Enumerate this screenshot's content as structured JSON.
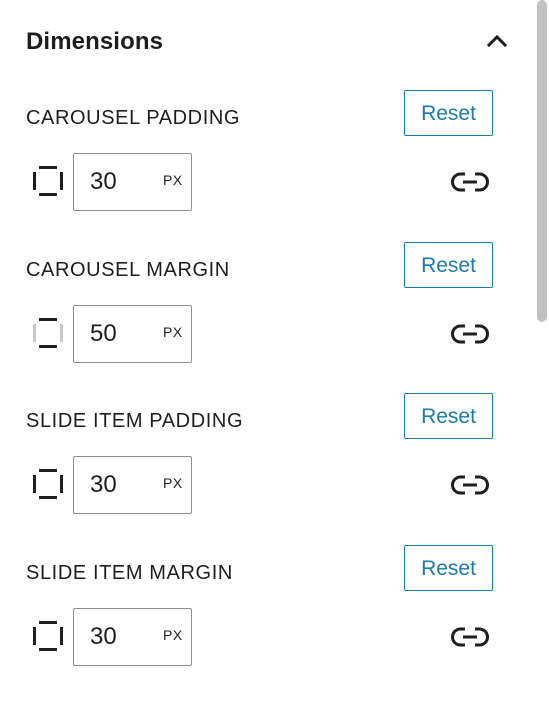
{
  "panel": {
    "title": "Dimensions",
    "expanded": true,
    "collapse_icon": "chevron-up-icon"
  },
  "sections": [
    {
      "label": "CAROUSEL PADDING",
      "reset_label": "Reset",
      "value": "30",
      "unit": "PX",
      "sides_icon": "all-sides-icon",
      "link_icon": "link-icon"
    },
    {
      "label": "CAROUSEL MARGIN",
      "reset_label": "Reset",
      "value": "50",
      "unit": "PX",
      "sides_icon": "vertical-sides-icon",
      "link_icon": "link-icon"
    },
    {
      "label": "SLIDE ITEM PADDING",
      "reset_label": "Reset",
      "value": "30",
      "unit": "PX",
      "sides_icon": "all-sides-icon",
      "link_icon": "link-icon"
    },
    {
      "label": "SLIDE ITEM MARGIN",
      "reset_label": "Reset",
      "value": "30",
      "unit": "PX",
      "sides_icon": "all-sides-icon",
      "link_icon": "link-icon"
    }
  ],
  "colors": {
    "accent": "#1a7cae",
    "text": "#1e1e1e",
    "border": "#8c8f94",
    "muted_icon": "#c8c8c8"
  }
}
